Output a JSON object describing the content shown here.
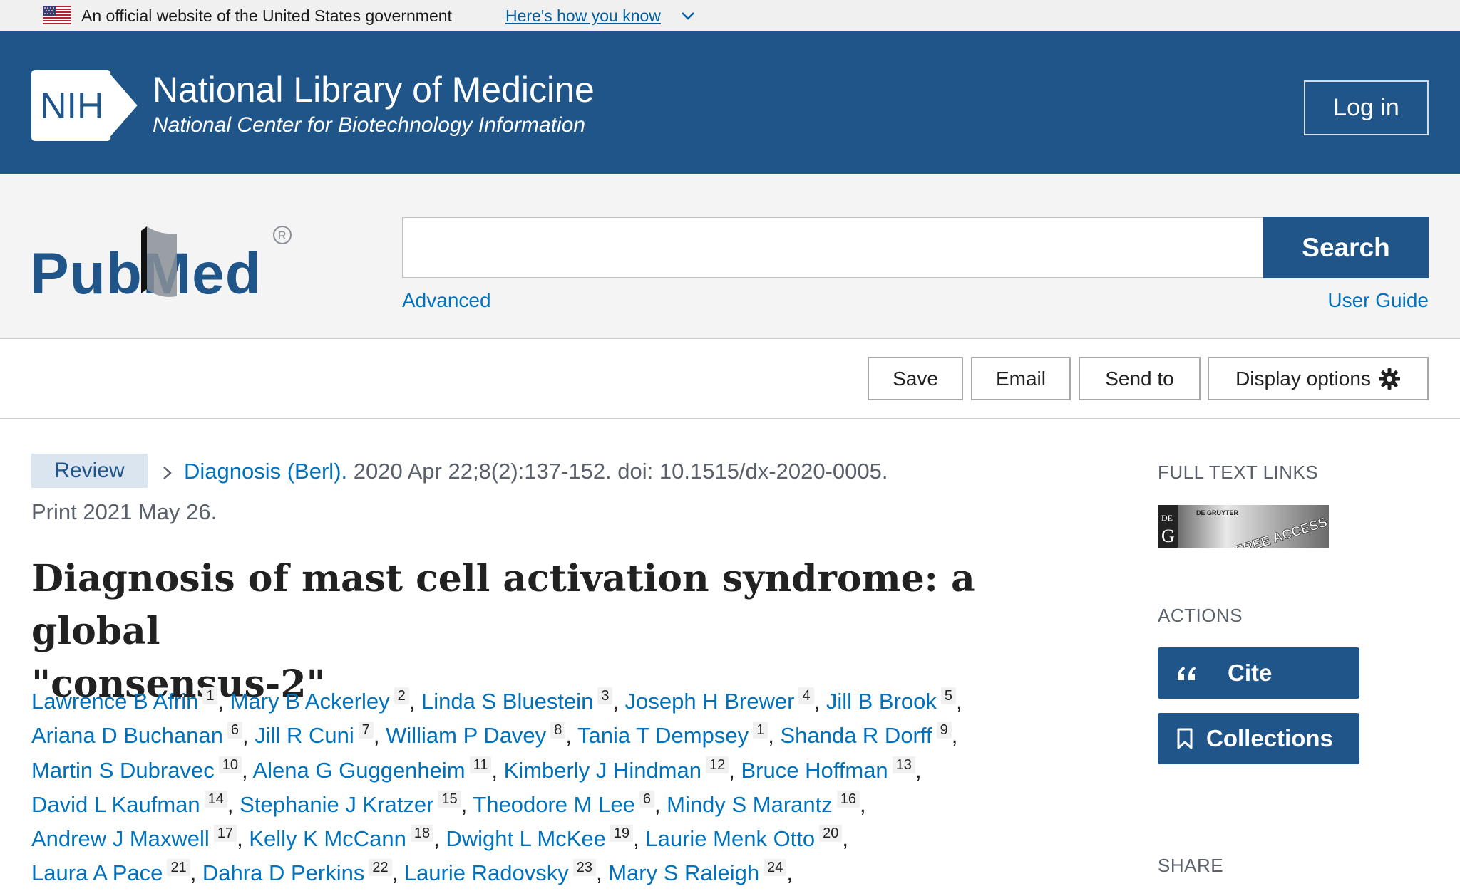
{
  "gov_banner": {
    "text": "An official website of the United States government",
    "link": "Here's how you know"
  },
  "nih": {
    "logo_text": "NIH",
    "title": "National Library of Medicine",
    "subtitle": "National Center for Biotechnology Information",
    "login": "Log in"
  },
  "search": {
    "logo_text": "PubMed",
    "placeholder": "",
    "button": "Search",
    "advanced": "Advanced",
    "user_guide": "User Guide"
  },
  "actions_bar": {
    "save": "Save",
    "email": "Email",
    "send_to": "Send to",
    "display_options": "Display options"
  },
  "article": {
    "type_badge": "Review",
    "journal": "Diagnosis (Berl).",
    "citation": " 2020 Apr 22;8(2):137-152. doi: 10.1515/dx-2020-0005.",
    "print_date": "Print 2021 May 26.",
    "title_line1": "Diagnosis of mast cell activation syndrome: a global",
    "title_line2": "\"consensus-2\"",
    "authors": [
      [
        {
          "name": "Lawrence B Afrin",
          "aff": "1"
        },
        {
          "name": "Mary B Ackerley",
          "aff": "2"
        },
        {
          "name": "Linda S Bluestein",
          "aff": "3"
        },
        {
          "name": "Joseph H Brewer",
          "aff": "4"
        },
        {
          "name": "Jill B Brook",
          "aff": "5"
        }
      ],
      [
        {
          "name": "Ariana D Buchanan",
          "aff": "6"
        },
        {
          "name": "Jill R Cuni",
          "aff": "7"
        },
        {
          "name": "William P Davey",
          "aff": "8"
        },
        {
          "name": "Tania T Dempsey",
          "aff": "1"
        },
        {
          "name": "Shanda R Dorff",
          "aff": "9"
        }
      ],
      [
        {
          "name": "Martin S Dubravec",
          "aff": "10"
        },
        {
          "name": "Alena G Guggenheim",
          "aff": "11"
        },
        {
          "name": "Kimberly J Hindman",
          "aff": "12"
        },
        {
          "name": "Bruce Hoffman",
          "aff": "13"
        }
      ],
      [
        {
          "name": "David L Kaufman",
          "aff": "14"
        },
        {
          "name": "Stephanie J Kratzer",
          "aff": "15"
        },
        {
          "name": "Theodore M Lee",
          "aff": "6"
        },
        {
          "name": "Mindy S Marantz",
          "aff": "16"
        }
      ],
      [
        {
          "name": "Andrew J Maxwell",
          "aff": "17"
        },
        {
          "name": "Kelly K McCann",
          "aff": "18"
        },
        {
          "name": "Dwight L McKee",
          "aff": "19"
        },
        {
          "name": "Laurie Menk Otto",
          "aff": "20"
        }
      ],
      [
        {
          "name": "Laura A Pace",
          "aff": "21"
        },
        {
          "name": "Dahra D Perkins",
          "aff": "22"
        },
        {
          "name": "Laurie Radovsky",
          "aff": "23"
        },
        {
          "name": "Mary S Raleigh",
          "aff": "24"
        }
      ]
    ]
  },
  "sidebar": {
    "full_text_heading": "FULL TEXT LINKS",
    "full_text_logo": {
      "publisher": "DE GRUYTER",
      "badge": "FREE ACCESS"
    },
    "actions_heading": "ACTIONS",
    "cite": "Cite",
    "collections": "Collections",
    "share_heading": "SHARE"
  },
  "colors": {
    "nih_blue": "#20558a",
    "link_blue": "#0071bc",
    "review_badge_bg": "#dbe5ef"
  }
}
